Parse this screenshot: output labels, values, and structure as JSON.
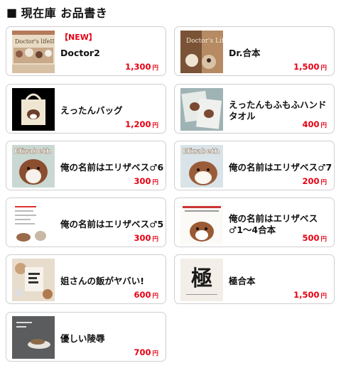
{
  "section": {
    "marker": "■",
    "title": "現在庫 お品書き"
  },
  "products": [
    {
      "badge": "【NEW】",
      "title": "Doctor2",
      "price": "1,300",
      "currency": "円",
      "thumb_icon": "doctor2-book-cover",
      "thumb_text": "Doctor's lifeII"
    },
    {
      "badge": "",
      "title": "Dr.合本",
      "price": "1,500",
      "currency": "円",
      "thumb_icon": "dr-omnibus-cover",
      "thumb_text": "Doctor's Life"
    },
    {
      "badge": "",
      "title": "えったんバッグ",
      "price": "1,200",
      "currency": "円",
      "thumb_icon": "tote-bag",
      "thumb_text": ""
    },
    {
      "badge": "",
      "title": "えったんもふもふハンドタオル",
      "price": "400",
      "currency": "円",
      "thumb_icon": "hand-towel",
      "thumb_text": ""
    },
    {
      "badge": "",
      "title": "俺の名前はエリザベス♂6",
      "price": "300",
      "currency": "円",
      "thumb_icon": "elizabeth6-cover",
      "thumb_text": "Elizabeth"
    },
    {
      "badge": "",
      "title": "俺の名前はエリザベス♂7",
      "price": "200",
      "currency": "円",
      "thumb_icon": "elizabeth7-cover",
      "thumb_text": "Elizabeth"
    },
    {
      "badge": "",
      "title": "俺の名前はエリザベス♂5",
      "price": "300",
      "currency": "円",
      "thumb_icon": "elizabeth5-cover",
      "thumb_text": ""
    },
    {
      "badge": "",
      "title": "俺の名前はエリザベス♂1〜4合本",
      "price": "500",
      "currency": "円",
      "thumb_icon": "elizabeth-omnibus-cover",
      "thumb_text": ""
    },
    {
      "badge": "",
      "title": "姐さんの飯がヤバい!",
      "price": "600",
      "currency": "円",
      "thumb_icon": "food-book-cover",
      "thumb_text": ""
    },
    {
      "badge": "",
      "title": "極合本",
      "price": "1,500",
      "currency": "円",
      "thumb_icon": "kiwami-cover",
      "thumb_text": "極"
    },
    {
      "badge": "",
      "title": "優しい陵辱",
      "price": "700",
      "currency": "円",
      "thumb_icon": "tea-cup-cover",
      "thumb_text": ""
    }
  ]
}
